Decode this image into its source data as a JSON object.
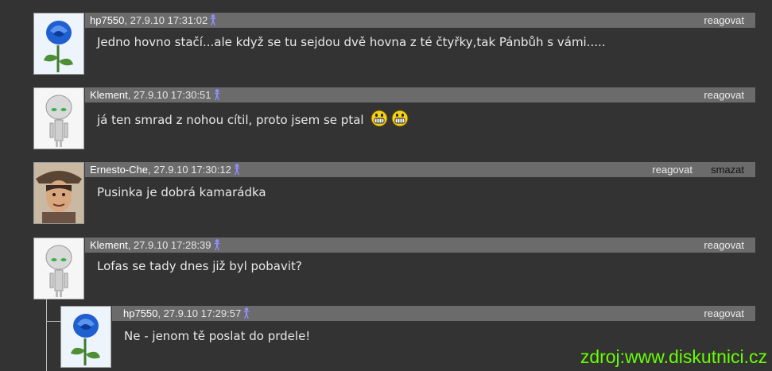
{
  "comments": [
    {
      "user": "hp7550",
      "date": ", 27.9.10 17:31:02",
      "text": "Jedno hovno stačí...ale když se tu sejdou dvě hovna z té čtyřky,tak Pánbůh s vámi.....",
      "reply": "reagovat",
      "avatar": "blue-rose"
    },
    {
      "user": "Klement",
      "date": ", 27.9.10 17:30:51",
      "text": "já ten smrad z nohou cítil, proto jsem se ptal",
      "reply": "reagovat",
      "avatar": "robot"
    },
    {
      "user": "Ernesto-Che",
      "date": ", 27.9.10 17:30:12",
      "text": "Pusinka je dobrá kamarádka",
      "reply": "reagovat",
      "delete": "smazat",
      "avatar": "portrait"
    },
    {
      "user": "Klement",
      "date": ", 27.9.10 17:28:39",
      "text": "Lofas se tady dnes již byl pobavit?",
      "reply": "reagovat",
      "avatar": "robot"
    },
    {
      "user": "hp7550",
      "date": ", 27.9.10 17:29:57",
      "text": "Ne - jenom tě poslat do prdele!",
      "reply": "reagovat",
      "avatar": "blue-rose"
    }
  ],
  "watermark": "zdroj:www.diskutnici.cz",
  "colors": {
    "background": "#333333",
    "header": "#6b6b6b",
    "watermark": "#66ff00",
    "icon": "#8f8fff"
  }
}
